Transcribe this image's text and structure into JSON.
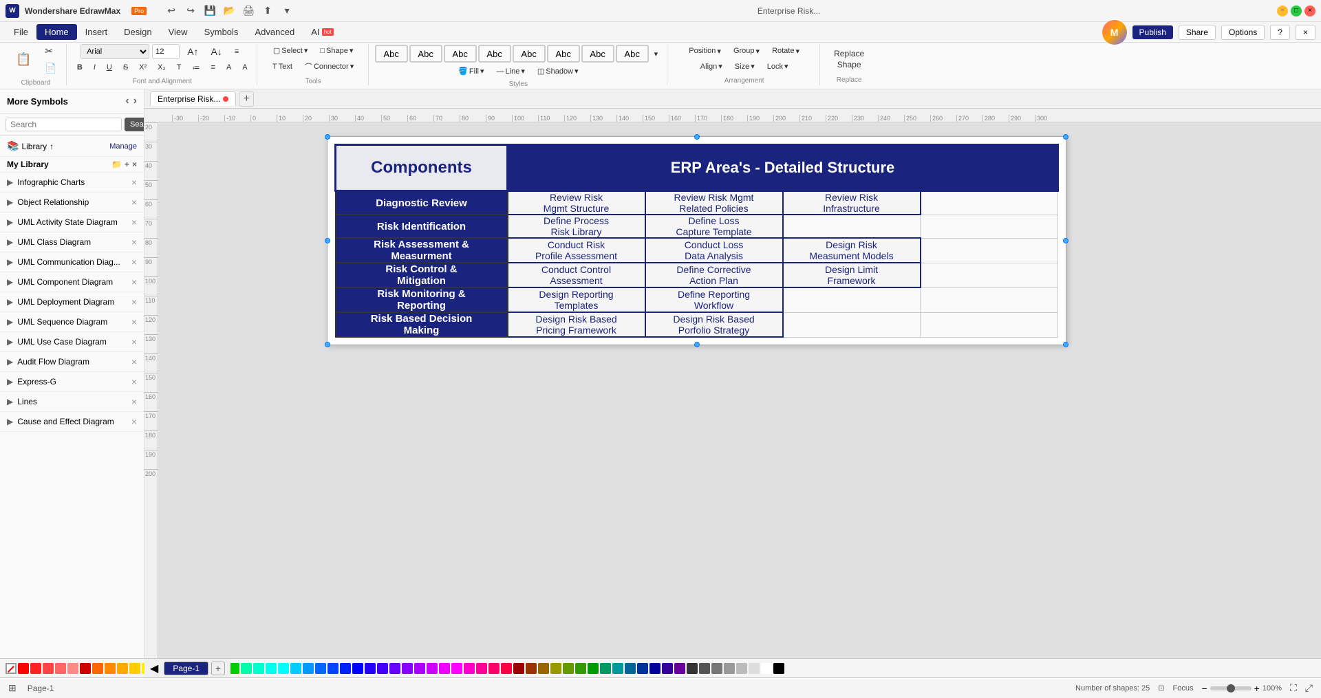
{
  "app": {
    "name": "Wondershare EdrawMax",
    "badge": "Pro",
    "title": "Enterprise Risk...",
    "tab_dot_color": "#ff4444"
  },
  "window_controls": {
    "minimize": "−",
    "maximize": "□",
    "close": "×"
  },
  "undo_redo": {
    "undo": "↩",
    "redo": "↪"
  },
  "menubar": {
    "items": [
      "File",
      "Home",
      "Insert",
      "Design",
      "View",
      "Symbols",
      "Advanced",
      "AI"
    ],
    "active": "Home",
    "ai_hot": "hot",
    "right": {
      "publish": "Publish",
      "share": "Share",
      "options": "Options",
      "help": "?",
      "close": "×"
    }
  },
  "toolbar": {
    "clipboard_group": "Clipboard",
    "font_group": "Font and Alignment",
    "tools_group": "Tools",
    "styles_group": "Styles",
    "arrangement_group": "Arrangement",
    "replace_group": "Replace",
    "font_name": "Arial",
    "font_size": "12",
    "bold": "B",
    "italic": "I",
    "underline": "U",
    "strikethrough": "S",
    "select_label": "Select",
    "shape_label": "Shape",
    "text_label": "Text",
    "connector_label": "Connector",
    "fill_label": "Fill",
    "line_label": "Line",
    "shadow_label": "Shadow",
    "position_label": "Position",
    "group_label": "Group",
    "rotate_label": "Rotate",
    "align_label": "Align",
    "size_label": "Size",
    "lock_label": "Lock",
    "replace_shape_label": "Replace Shape",
    "style_abcs": [
      "Abc",
      "Abc",
      "Abc",
      "Abc",
      "Abc",
      "Abc",
      "Abc",
      "Abc"
    ]
  },
  "sidebar": {
    "title": "More Symbols",
    "search_placeholder": "Search",
    "search_btn": "Search",
    "library_label": "Library",
    "manage_label": "Manage",
    "my_library": "My Library",
    "items": [
      "Infographic Charts",
      "Object Relationship",
      "UML Activity State Diagram",
      "UML Class Diagram",
      "UML Communication Diag...",
      "UML Component Diagram",
      "UML Deployment Diagram",
      "UML Sequence Diagram",
      "UML Use Case Diagram",
      "Audit Flow Diagram",
      "Express-G",
      "Lines",
      "Cause and Effect Diagram"
    ]
  },
  "tabs": {
    "current": "Enterprise Risk...",
    "dot": true,
    "add": "+"
  },
  "diagram": {
    "header_left": "Components",
    "header_right": "ERP Area's - Detailed Structure",
    "rows": [
      {
        "component": "Diagnostic Review",
        "cells": [
          "Review Risk\nMgmt Structure",
          "Review Risk Mgmt\nRelated Policies",
          "Review Risk\nInfrastructure",
          ""
        ]
      },
      {
        "component": "Risk Identification",
        "cells": [
          "Define Process\nRisk Library",
          "Define Loss\nCapture Template",
          "",
          ""
        ]
      },
      {
        "component": "Risk Assessment &\nMeasurment",
        "cells": [
          "Conduct Risk\nProfile Assessment",
          "Conduct Loss\nData Analysis",
          "Design Risk\nMeasument Models",
          ""
        ]
      },
      {
        "component": "Risk Control &\nMitigation",
        "cells": [
          "Conduct Control\nAssessment",
          "Define Corrective\nAction Plan",
          "Design Limit\nFramework",
          ""
        ]
      },
      {
        "component": "Risk Monitoring &\nReporting",
        "cells": [
          "Design Reporting\nTemplates",
          "Define Reporting\nWorkflow",
          "",
          ""
        ]
      },
      {
        "component": "Risk Based Decision\nMaking",
        "cells": [
          "Design Risk Based\nPricing Framework",
          "Design Risk Based\nPorfolio Strategy",
          "",
          ""
        ]
      }
    ]
  },
  "statusbar": {
    "shapes_count": "Number of shapes: 25",
    "focus_label": "Focus",
    "zoom_label": "100%",
    "page_label": "Page-1"
  },
  "page_tabs": {
    "pages": [
      "Page-1"
    ],
    "active": "Page-1",
    "add": "+"
  },
  "colors": [
    "#ff0000",
    "#ff2222",
    "#ff4444",
    "#ff6666",
    "#ff8888",
    "#cc0000",
    "#ff6600",
    "#ff8800",
    "#ffaa00",
    "#ffcc00",
    "#ffee00",
    "#ffff00",
    "#aaff00",
    "#88ff00",
    "#66ff00",
    "#44ff00",
    "#00ff00",
    "#00cc00",
    "#00ffaa",
    "#00ffcc",
    "#00ffee",
    "#00ffff",
    "#00ccff",
    "#0099ff",
    "#0066ff",
    "#0044ff",
    "#0022ff",
    "#0000ff",
    "#2200ff",
    "#4400ff",
    "#6600ff",
    "#8800ff",
    "#aa00ff",
    "#cc00ff",
    "#ee00ff",
    "#ff00ff",
    "#ff00cc",
    "#ff0099",
    "#ff0066",
    "#ff0044",
    "#990000",
    "#993300",
    "#996600",
    "#999900",
    "#669900",
    "#339900",
    "#009900",
    "#009966",
    "#009999",
    "#006699",
    "#003399",
    "#000099",
    "#330099",
    "#660099",
    "#333333",
    "#555555",
    "#777777",
    "#999999",
    "#bbbbbb",
    "#dddddd",
    "#ffffff",
    "#000000"
  ]
}
